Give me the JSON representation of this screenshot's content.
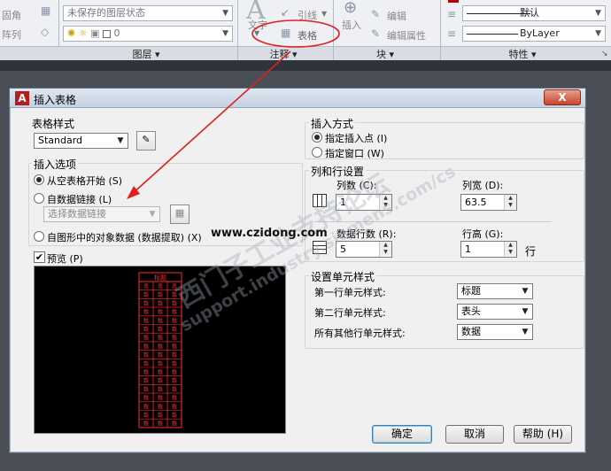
{
  "ribbon": {
    "left_labels": [
      "固角",
      "阵列"
    ],
    "layer_state": "未保存的图层状态",
    "layer_combo_value": "0",
    "annotation": {
      "text_label": "文字",
      "leader_label": "引线",
      "table_label": "表格"
    },
    "block": {
      "insert_label": "插入",
      "edit_label": "编辑",
      "edit_attr_label": "编辑属性"
    },
    "properties": {
      "color_value": "默认",
      "linetype_value": "ByLayer"
    },
    "panels": {
      "layers": "图层",
      "annotation": "注释",
      "block": "块",
      "properties": "特性"
    }
  },
  "dialog": {
    "title": "插入表格",
    "close_glyph": "X",
    "logo_letter": "A",
    "table_style": {
      "group_label": "表格样式",
      "value": "Standard"
    },
    "insert_options": {
      "group_label": "插入选项",
      "option_empty": "从空表格开始 (S)",
      "option_link": "自数据链接 (L)",
      "link_placeholder": "选择数据链接",
      "option_extract": "自图形中的对象数据 (数据提取) (X)"
    },
    "preview": {
      "label": "预览 (P)",
      "checked": true,
      "title_cell": "标题",
      "header_cell": "表",
      "data_cell": "数"
    },
    "insert_method": {
      "group_label": "插入方式",
      "option_point": "指定插入点 (I)",
      "option_window": "指定窗口 (W)"
    },
    "column_row": {
      "group_label": "列和行设置",
      "columns_label": "列数 (C):",
      "columns_value": "1",
      "col_width_label": "列宽 (D):",
      "col_width_value": "63.5",
      "rows_label": "数据行数 (R):",
      "rows_value": "5",
      "row_height_label": "行高 (G):",
      "row_height_value": "1",
      "row_unit": "行"
    },
    "cell_styles": {
      "group_label": "设置单元样式",
      "first_row_label": "第一行单元样式:",
      "first_row_value": "标题",
      "second_row_label": "第二行单元样式:",
      "second_row_value": "表头",
      "other_rows_label": "所有其他行单元样式:",
      "other_rows_value": "数据"
    },
    "buttons": {
      "ok": "确定",
      "cancel": "取消",
      "help": "帮助 (H)"
    }
  },
  "overlay": {
    "website": "www.czidong.com",
    "watermark_cn": "西门子工业支持论坛",
    "watermark_en": "support.industry.siemens.com/cs"
  },
  "colors": {
    "annotation": "#e02020",
    "preview_lines": "#ff2a2a",
    "accent": "#3c7fb1"
  }
}
